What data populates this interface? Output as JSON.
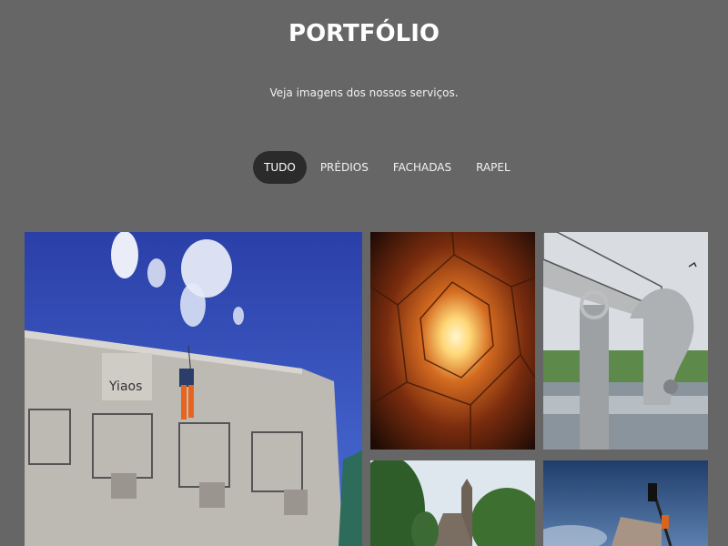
{
  "header": {
    "title": "PORTFÓLIO",
    "subtitle": "Veja imagens dos nossos serviços."
  },
  "filters": [
    {
      "label": "TUDO",
      "active": true
    },
    {
      "label": "PRÉDIOS",
      "active": false
    },
    {
      "label": "FACHADAS",
      "active": false
    },
    {
      "label": "RAPEL",
      "active": false
    }
  ],
  "gallery": {
    "items": [
      {
        "subject": "rope-access worker on building facade"
      },
      {
        "subject": "building courtyard looking up"
      },
      {
        "subject": "rotating boat lift bridge"
      },
      {
        "subject": "old church tower among trees"
      },
      {
        "subject": "crane over building"
      }
    ]
  },
  "colors": {
    "background": "#666666",
    "active_filter_bg": "#2b2b2b",
    "text": "#ffffff"
  }
}
